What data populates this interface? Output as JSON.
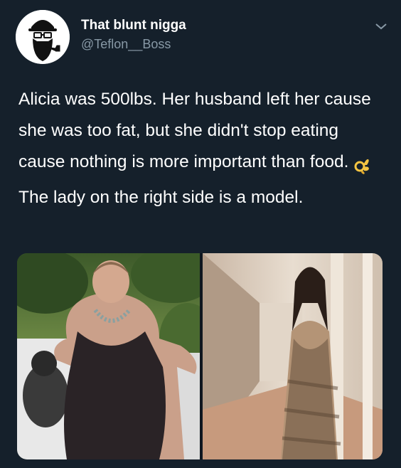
{
  "tweet": {
    "author": {
      "display_name": "That blunt nigga",
      "handle": "@Teflon__Boss",
      "avatar_icon": "bearded-man-avatar"
    },
    "menu_icon": "chevron-down-icon",
    "paragraphs": [
      "Alicia was 500lbs. Her husband left her cause she was too fat, but she didn't stop eating cause nothing is more important than food.",
      "The lady on the right side is a model."
    ],
    "emoji": "ok-hand-emoji",
    "media": {
      "count": 2,
      "images": [
        {
          "description_icon": "photo-left"
        },
        {
          "description_icon": "photo-right"
        }
      ]
    }
  },
  "colors": {
    "background": "#15202b",
    "text": "#ffffff",
    "secondary_text": "#8899a6"
  }
}
